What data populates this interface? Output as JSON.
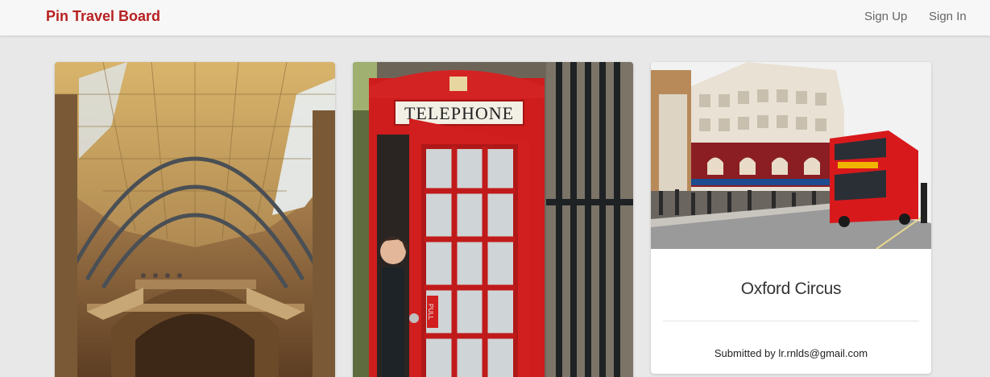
{
  "navbar": {
    "brand": "Pin Travel Board",
    "links": [
      "Sign Up",
      "Sign In"
    ]
  },
  "pins": [
    {
      "image_subject": "museum vaulted hall interior"
    },
    {
      "image_subject": "red telephone box",
      "sign_text": "TELEPHONE",
      "door_text": "PULL"
    },
    {
      "image_subject": "street with red double-decker bus",
      "title": "Oxford Circus",
      "submitted": "Submitted by lr.rnlds@gmail.com"
    }
  ],
  "colors": {
    "brand": "#b72121",
    "background": "#e8e8e8",
    "navbar": "#f7f7f7"
  }
}
